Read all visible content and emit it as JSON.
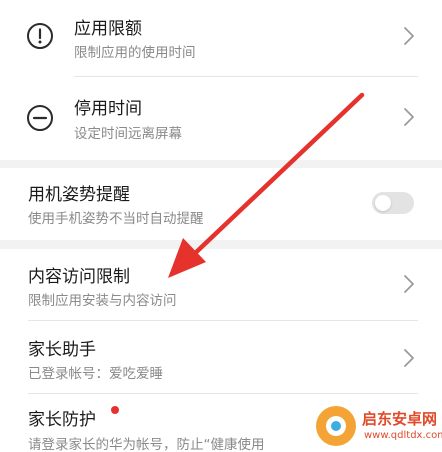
{
  "items": {
    "app_limits": {
      "title": "应用限额",
      "subtitle": "限制应用的使用时间"
    },
    "downtime": {
      "title": "停用时间",
      "subtitle": "设定时间远离屏幕"
    },
    "posture": {
      "title": "用机姿势提醒",
      "subtitle": "使用手机姿势不当时自动提醒",
      "toggle_on": false
    },
    "content_restrictions": {
      "title": "内容访问限制",
      "subtitle": "限制应用安装与内容访问"
    },
    "parent_assistant": {
      "title": "家长助手",
      "subtitle": "已登录帐号：爱吃爱睡"
    },
    "parent_protection": {
      "title": "家长防护",
      "subtitle": "请登录家长的华为帐号，防止“健康使用"
    }
  },
  "watermark": {
    "name": "启东安卓网",
    "url": "www.qdltdx.com"
  },
  "colors": {
    "arrow": "#e5322d",
    "badge": "#e5322d",
    "toggle_off": "#e3e3e3",
    "subtitle": "#8a8a8a"
  },
  "icons": {
    "app_limits": "exclamation-circle-icon",
    "downtime": "minus-circle-icon",
    "chevron": "chevron-right-icon"
  }
}
